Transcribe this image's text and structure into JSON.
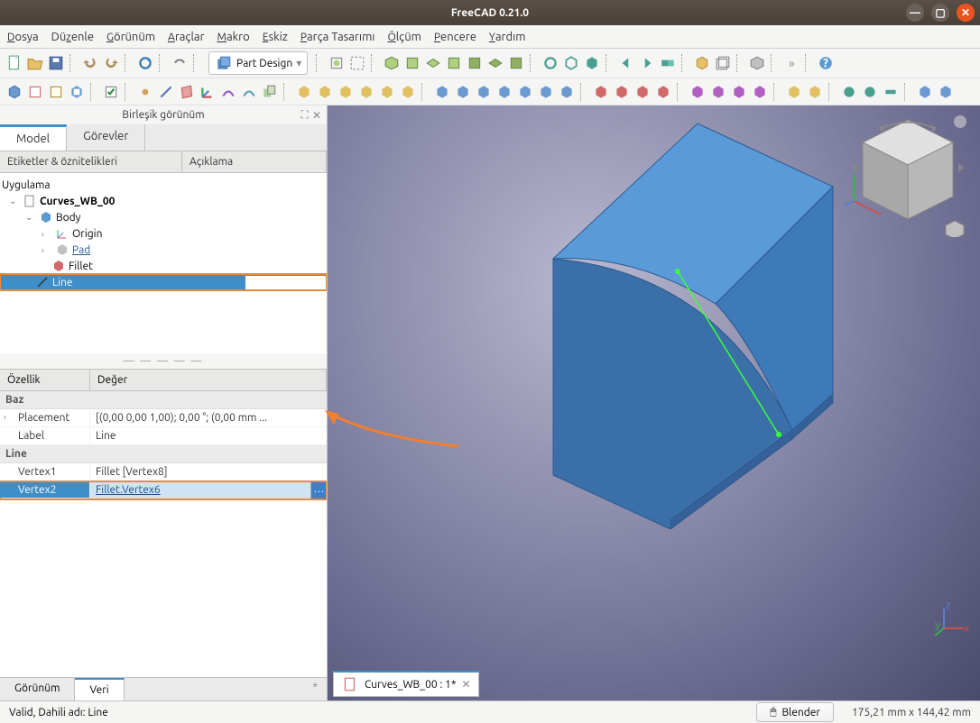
{
  "window": {
    "title": "FreeCAD 0.21.0"
  },
  "menu": {
    "file": "Dosya",
    "edit": "Düzenle",
    "view": "Görünüm",
    "tools": "Araçlar",
    "macro": "Makro",
    "sketch": "Eskiz",
    "partdesign": "Parça Tasarımı",
    "measure": "Ölçüm",
    "windows": "Pencere",
    "help": "Yardım"
  },
  "workbench": {
    "label": "Part Design"
  },
  "panel": {
    "title": "Birleşik görünüm"
  },
  "tabs": {
    "model": "Model",
    "tasks": "Görevler"
  },
  "treeHeader": {
    "labels": "Etiketler & öznitelikleri",
    "desc": "Açıklama"
  },
  "tree": {
    "root": "Uygulama",
    "doc": "Curves_WB_00",
    "body": "Body",
    "origin": "Origin",
    "pad": "Pad",
    "fillet": "Fillet",
    "line": "Line"
  },
  "propHeader": {
    "name": "Özellik",
    "value": "Değer"
  },
  "props": {
    "group1": "Baz",
    "placement_name": "Placement",
    "placement_val": "[(0,00 0,00 1,00); 0,00 °; (0,00 mm   ...",
    "label_name": "Label",
    "label_val": "Line",
    "group2": "Line",
    "v1_name": "Vertex1",
    "v1_val": "Fillet [Vertex8]",
    "v2_name": "Vertex2",
    "v2_val": "Fillet.Vertex6"
  },
  "bottomTabs": {
    "view": "Görünüm",
    "data": "Veri"
  },
  "docTab": {
    "label": "Curves_WB_00 : 1*"
  },
  "status": {
    "msg": "Valid, Dahili adı: Line",
    "style": "Blender",
    "dims": "175,21 mm x 144,42 mm"
  }
}
